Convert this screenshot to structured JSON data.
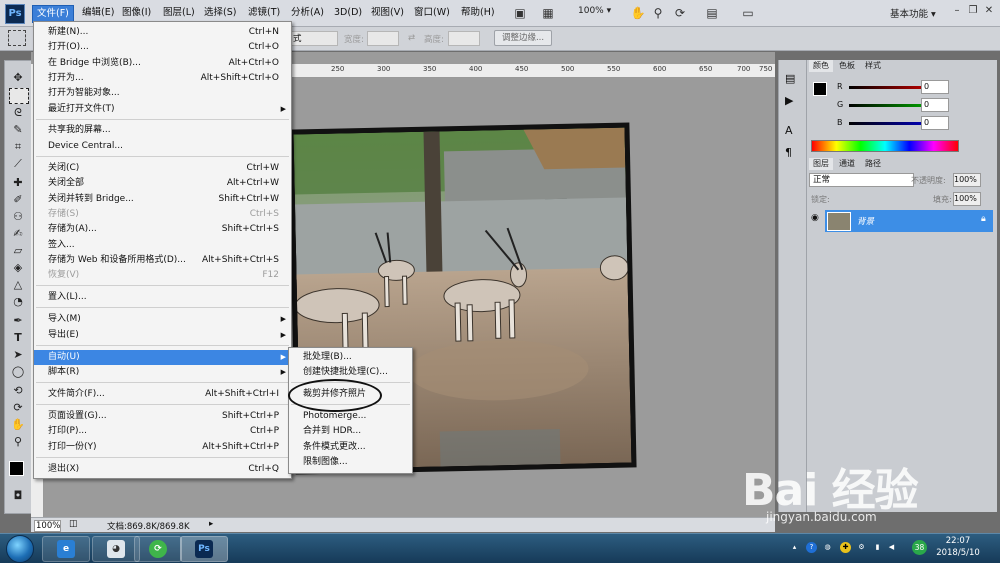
{
  "menubar": {
    "logo": "Ps",
    "items": [
      "文件(F)",
      "编辑(E)",
      "图像(I)",
      "图层(L)",
      "选择(S)",
      "滤镜(T)",
      "分析(A)",
      "3D(D)",
      "视图(V)",
      "窗口(W)",
      "帮助(H)"
    ],
    "zoom": "100%",
    "workspace": "基本功能"
  },
  "options": {
    "style_value": "式",
    "width_label": "宽度:",
    "height_label": "高度:",
    "refine_button": "调整边缘..."
  },
  "ruler": {
    "ticks": [
      "250",
      "300",
      "350",
      "400",
      "450",
      "500",
      "550",
      "600",
      "650",
      "700",
      "750"
    ]
  },
  "file_menu": {
    "items": [
      {
        "label": "新建(N)...",
        "shortcut": "Ctrl+N"
      },
      {
        "label": "打开(O)...",
        "shortcut": "Ctrl+O"
      },
      {
        "label": "在 Bridge 中浏览(B)...",
        "shortcut": "Alt+Ctrl+O"
      },
      {
        "label": "打开为...",
        "shortcut": "Alt+Shift+Ctrl+O"
      },
      {
        "label": "打开为智能对象...",
        "shortcut": ""
      },
      {
        "label": "最近打开文件(T)",
        "shortcut": ""
      },
      {
        "label": "共享我的屏幕...",
        "shortcut": ""
      },
      {
        "label": "Device Central...",
        "shortcut": ""
      },
      {
        "label": "关闭(C)",
        "shortcut": "Ctrl+W"
      },
      {
        "label": "关闭全部",
        "shortcut": "Alt+Ctrl+W"
      },
      {
        "label": "关闭并转到 Bridge...",
        "shortcut": "Shift+Ctrl+W"
      },
      {
        "label": "存储(S)",
        "shortcut": "Ctrl+S"
      },
      {
        "label": "存储为(A)...",
        "shortcut": "Shift+Ctrl+S"
      },
      {
        "label": "签入...",
        "shortcut": ""
      },
      {
        "label": "存储为 Web 和设备所用格式(D)...",
        "shortcut": "Alt+Shift+Ctrl+S"
      },
      {
        "label": "恢复(V)",
        "shortcut": "F12"
      },
      {
        "label": "置入(L)...",
        "shortcut": ""
      },
      {
        "label": "导入(M)",
        "shortcut": ""
      },
      {
        "label": "导出(E)",
        "shortcut": ""
      },
      {
        "label": "自动(U)",
        "shortcut": ""
      },
      {
        "label": "脚本(R)",
        "shortcut": ""
      },
      {
        "label": "文件简介(F)...",
        "shortcut": "Alt+Shift+Ctrl+I"
      },
      {
        "label": "页面设置(G)...",
        "shortcut": "Shift+Ctrl+P"
      },
      {
        "label": "打印(P)...",
        "shortcut": "Ctrl+P"
      },
      {
        "label": "打印一份(Y)",
        "shortcut": "Alt+Shift+Ctrl+P"
      },
      {
        "label": "退出(X)",
        "shortcut": "Ctrl+Q"
      }
    ]
  },
  "auto_submenu": {
    "items": [
      "批处理(B)...",
      "创建快捷批处理(C)...",
      "裁剪并修齐照片",
      "Photomerge...",
      "合并到 HDR...",
      "条件模式更改...",
      "限制图像..."
    ]
  },
  "statusbar": {
    "zoom": "100%",
    "doc_info": "文档:869.8K/869.8K"
  },
  "panels": {
    "color_tabs": [
      "颜色",
      "色板",
      "样式"
    ],
    "channels": [
      {
        "label": "R",
        "value": "0"
      },
      {
        "label": "G",
        "value": "0"
      },
      {
        "label": "B",
        "value": "0"
      }
    ],
    "layer_tabs": [
      "图层",
      "通道",
      "路径"
    ],
    "blend_mode": "正常",
    "opacity_label": "不透明度:",
    "opacity_value": "100%",
    "lock_label": "锁定:",
    "fill_label": "填充:",
    "fill_value": "100%",
    "layer_name": "背景"
  },
  "taskbar": {
    "time": "22:07",
    "date": "2018/5/10",
    "tray_badge": "38",
    "ps_label": "Ps"
  },
  "watermark": {
    "logo": "Bai 经验",
    "url": "jingyan.baidu.com"
  },
  "colors": {
    "accent": "#3c86e3",
    "menu_bg": "#f4f4f4",
    "annotation": "#111111"
  }
}
